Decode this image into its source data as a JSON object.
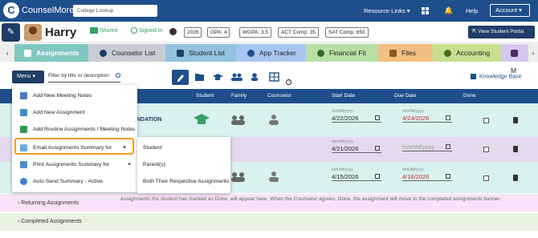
{
  "topnav": {
    "logo_glyph": "C",
    "brand": "CounselMore",
    "lookup_placeholder": "College Lookup",
    "resource_links": "Resource Links ▾",
    "help": "Help",
    "account": "Account ▾"
  },
  "student": {
    "name": "Harry",
    "shared": "Shared",
    "signed_in": "Signed In",
    "year": "2026",
    "gpa": "GPA: 4",
    "wgpa": "WGPA: 3.5",
    "act": "ACT Comp: 35",
    "sat": "SAT  Comp: 650",
    "view_portal": "View Student Portal"
  },
  "tabs": [
    {
      "label": "Assignments",
      "color": "#7fc7c0",
      "icon_color": "#ffffff"
    },
    {
      "label": "Counselor List",
      "color": "#c9ccd4",
      "icon_color": "#1f3d66"
    },
    {
      "label": "Student List",
      "color": "#93c3de",
      "icon_color": "#1f3d66"
    },
    {
      "label": "App Tracker",
      "color": "#a7c7f2",
      "icon_color": "#1f4e8c"
    },
    {
      "label": "Financial Fit",
      "color": "#b8e0a6",
      "icon_color": "#2d6b2d"
    },
    {
      "label": "Files",
      "color": "#f2bf82",
      "icon_color": "#8a5a1f"
    },
    {
      "label": "Accounting",
      "color": "#c7e08f",
      "icon_color": "#4a6b1f"
    },
    {
      "label": "M",
      "color": "#d6c7ec",
      "icon_color": "#4a2d6b"
    }
  ],
  "toolbar": {
    "menu_label": "Menu ▾",
    "filter_placeholder": "Filter by title or description",
    "knowledge_base": "Knowledge Base",
    "icons": [
      "pencil-icon",
      "folder-icon",
      "graduation-cap-icon",
      "people-icon",
      "person-icon",
      "grid-icon"
    ]
  },
  "table_header": {
    "student": "Student",
    "family": "Family",
    "counselor": "Counselor",
    "start_date": "Start Date",
    "due_date": "Due Date",
    "done": "Done"
  },
  "rows": [
    {
      "title_fragment": "NDATION",
      "start_placeholder": "mm/dd/yyyy",
      "start": "4/22/2026",
      "due_placeholder": "mm/dd/yyyy",
      "due": "4/24/2026",
      "due_color": "#c03030",
      "bg": "#d9f1f0"
    },
    {
      "start_placeholder": "mm/dd/yyyy",
      "start": "4/21/2026",
      "due": "mm/dd/yyyy",
      "due_color": "#999999",
      "bg": "#e6d9ee"
    },
    {
      "start_placeholder": "mm/dd/yyyy",
      "start": "4/15/2026",
      "due_placeholder": "mm/dd/yyyy",
      "due": "4/16/2026",
      "due_color": "#c03030",
      "bg": "#d9f1f0"
    }
  ],
  "sections": {
    "returning": "Returning Assignments",
    "returning_note": "Assignments the student has marked as Done, will appear here. When the Counselor agrees, Done, the assignment will move to the completed assignments banner.",
    "completed": "Completed Assignments"
  },
  "menu": {
    "items": [
      {
        "label": "Add New Meeting Notes",
        "icon": "notes-icon"
      },
      {
        "label": "Add New Assignment",
        "icon": "list-add-icon"
      },
      {
        "label": "Add Routine Assignments / Meeting Notes",
        "icon": "folder-add-icon"
      },
      {
        "label": "Email Assignments Summary for",
        "icon": "email-icon",
        "arrow": "▸"
      },
      {
        "label": "Print Assignments Summary for",
        "icon": "print-icon",
        "arrow": "▸"
      },
      {
        "label": "Auto Send Summary - Active",
        "icon": "clock-icon"
      }
    ],
    "submenu": [
      "Student",
      "Parent(s)",
      "Both Their Respective Assignments"
    ]
  },
  "colors": {
    "nav": "#1f4e8c",
    "dark": "#1f3d66",
    "green": "#39a067",
    "highlight": "#f0a020",
    "due_red": "#c03030"
  }
}
